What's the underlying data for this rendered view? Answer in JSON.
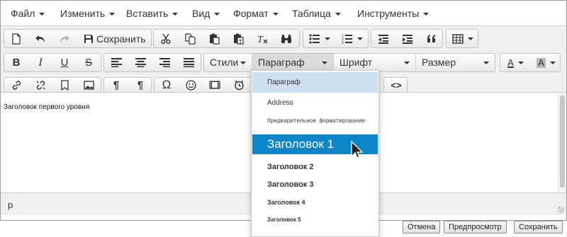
{
  "menubar": {
    "items": [
      {
        "label": "Файл"
      },
      {
        "label": "Изменить"
      },
      {
        "label": "Вставить"
      },
      {
        "label": "Вид"
      },
      {
        "label": "Формат"
      },
      {
        "label": "Таблица"
      },
      {
        "label": "Инструменты"
      }
    ]
  },
  "toolbar1": {
    "save_label": "Сохранить",
    "icons": [
      "new-document-icon",
      "undo-icon",
      "redo-icon",
      "save-icon",
      "cut-icon",
      "copy-icon",
      "paste-icon",
      "paste-text-icon",
      "clear-formatting-icon",
      "find-icon",
      "bullet-list-icon",
      "numbered-list-icon",
      "outdent-icon",
      "indent-icon",
      "blockquote-icon",
      "table-icon"
    ]
  },
  "toolbar2": {
    "bold": "B",
    "italic": "I",
    "underline": "U",
    "strikethrough": "S",
    "styles": "Стили",
    "paragraph": "Параграф",
    "font": "Шрифт",
    "size": "Размер",
    "text_color": "A",
    "bg_color": "A"
  },
  "toolbar3": {
    "icons": [
      "link-icon",
      "unlink-icon",
      "bookmark-icon",
      "image-icon",
      "ltr-paragraph-icon",
      "rtl-paragraph-icon",
      "omega-icon",
      "emoticon-icon",
      "media-icon",
      "clock-icon",
      "code-icon"
    ],
    "omega": "Ω",
    "code": "<>"
  },
  "content": {
    "text": "Заголовок первого уровня"
  },
  "statusbar": {
    "path": "p"
  },
  "buttons": {
    "cancel": "Отмена",
    "preview": "Предпросмотр",
    "save": "Сохранить"
  },
  "dropdown": {
    "items": [
      {
        "label": "Параграф",
        "state": "current"
      },
      {
        "label": "Address",
        "state": ""
      },
      {
        "label": "Предварительное форматирование",
        "state": ""
      },
      {
        "label": "Заголовок 1",
        "state": "hover"
      },
      {
        "label": "Заголовок 2",
        "state": ""
      },
      {
        "label": "Заголовок 3",
        "state": ""
      },
      {
        "label": "Заголовок 4",
        "state": ""
      },
      {
        "label": "Заголовок 5",
        "state": ""
      }
    ]
  },
  "colors": {
    "accent": "#0c86c8",
    "selected": "#cde0f2",
    "toolbar": "#f0f0f0"
  }
}
